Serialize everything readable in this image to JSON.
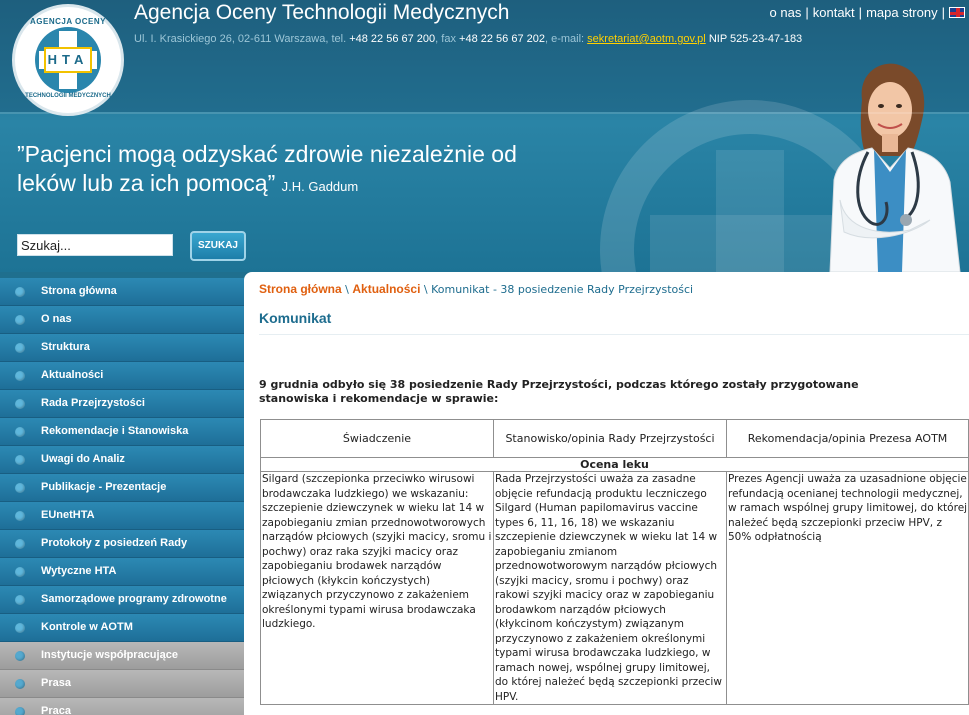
{
  "header": {
    "logo_top_text": "AGENCJA OCENY",
    "logo_center_text": "HTA",
    "logo_bottom_text": "TECHNOLOGII MEDYCZNYCH",
    "site_title": "Agencja Oceny Technologii Medycznych",
    "address": "Ul. I. Krasickiego 26, 02-611 Warszawa, tel.",
    "phone": "+48 22 56 67 200",
    "fax_label": ", fax",
    "fax": "+48 22 56 67 202",
    "email_label": ", e-mail:",
    "email": "sekretariat@aotm.gov.pl",
    "nip": "NIP 525-23-47-183",
    "top_nav": [
      "o nas",
      "kontakt",
      "mapa strony"
    ],
    "language_icon": "uk-flag-icon",
    "quote": "”Pacjenci mogą odzyskać zdrowie niezależnie od leków lub za ich pomocą”",
    "quote_author": "J.H. Gaddum",
    "search_value": "Szukaj...",
    "search_button": "SZUKAJ"
  },
  "sidebar": {
    "items": [
      {
        "label": "Strona główna"
      },
      {
        "label": "O nas"
      },
      {
        "label": "Struktura"
      },
      {
        "label": "Aktualności"
      },
      {
        "label": "Rada Przejrzystości"
      },
      {
        "label": "Rekomendacje i Stanowiska"
      },
      {
        "label": "Uwagi do Analiz"
      },
      {
        "label": "Publikacje - Prezentacje"
      },
      {
        "label": "EUnetHTA"
      },
      {
        "label": "Protokoły z posiedzeń Rady"
      },
      {
        "label": "Wytyczne HTA"
      },
      {
        "label": "Samorządowe programy zdrowotne"
      },
      {
        "label": "Kontrole w AOTM"
      },
      {
        "label": "Instytucje współpracujące"
      },
      {
        "label": "Prasa"
      },
      {
        "label": "Praca"
      }
    ]
  },
  "main": {
    "breadcrumb": [
      "Strona główna",
      "Aktualności",
      "Komunikat - 38 posiedzenie Rady Przejrzystości"
    ],
    "title": "Komunikat",
    "intro": "9 grudnia odbyło się 38 posiedzenie Rady Przejrzystości, podczas którego zostały przygotowane stanowiska i rekomendacje w sprawie:",
    "table": {
      "headers": [
        "Świadczenie",
        "Stanowisko/opinia Rady Przejrzystości",
        "Rekomendacja/opinia Prezesa AOTM"
      ],
      "section": "Ocena leku",
      "rows": [
        [
          "Silgard (szczepionka przeciwko wirusowi brodawczaka ludzkiego) we wskazaniu: szczepienie dziewczynek w wieku lat 14 w zapobieganiu zmian przednowotworowych narządów płciowych (szyjki macicy, sromu i pochwy) oraz raka szyjki macicy oraz zapobieganiu brodawek narządów płciowych (kłykcin kończystych) związanych przyczynowo z zakażeniem określonymi typami wirusa brodawczaka ludzkiego.",
          "Rada Przejrzystości uważa za zasadne objęcie refundacją produktu leczniczego Silgard (Human papilomavirus vaccine types 6, 11, 16, 18) we wskazaniu szczepienie dziewczynek w wieku lat 14 w zapobieganiu zmianom przednowotworowym narządów płciowych (szyjki macicy, sromu i pochwy) oraz rakowi szyjki macicy oraz w zapobieganiu brodawkom narządów płciowych (kłykcinom kończystym) związanym przyczynowo z zakażeniem określonymi typami wirusa brodawczaka ludzkiego, w ramach nowej, wspólnej grupy limitowej, do której należeć będą szczepionki przeciw HPV.",
          "Prezes Agencji uważa za uzasadnione objęcie refundacją ocenianej technologii medycznej, w ramach wspólnej grupy limitowej, do której należeć będą szczepionki przeciw HPV, z 50% odpłatnością"
        ]
      ]
    }
  }
}
